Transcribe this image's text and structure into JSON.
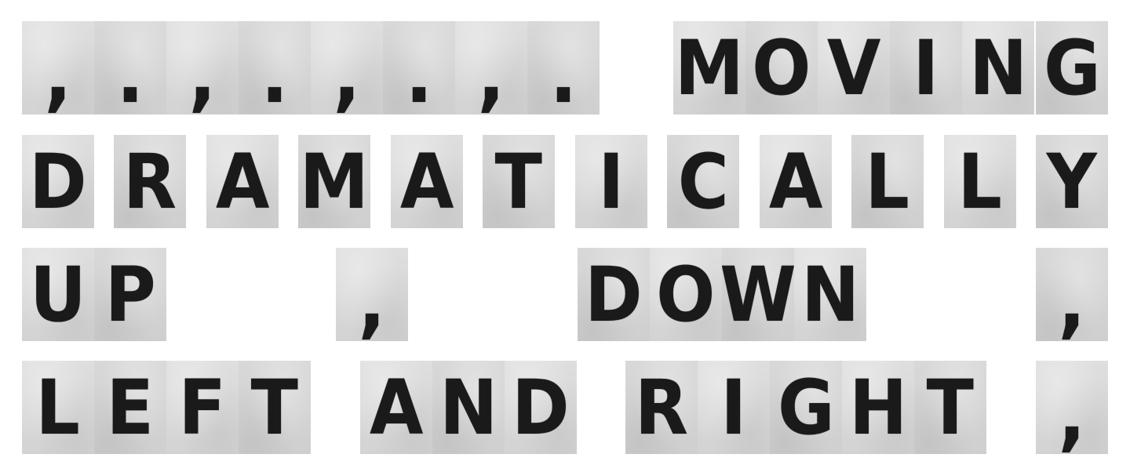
{
  "rows": [
    {
      "tiles": [
        ",",
        ".",
        ",",
        ".",
        ",",
        ".",
        ",",
        ".",
        "M",
        "O",
        "V",
        "I",
        "N",
        "G"
      ]
    },
    {
      "tiles": [
        "D",
        "R",
        "A",
        "M",
        "A",
        "T",
        "I",
        "C",
        "A",
        "L",
        "L",
        "Y"
      ]
    },
    {
      "tiles": [
        "U",
        "P",
        ",",
        "D",
        "O",
        "W",
        "N",
        ","
      ]
    },
    {
      "tiles": [
        "L",
        "E",
        "F",
        "T",
        "A",
        "N",
        "D",
        "R",
        "I",
        "G",
        "H",
        "T",
        ","
      ]
    }
  ]
}
